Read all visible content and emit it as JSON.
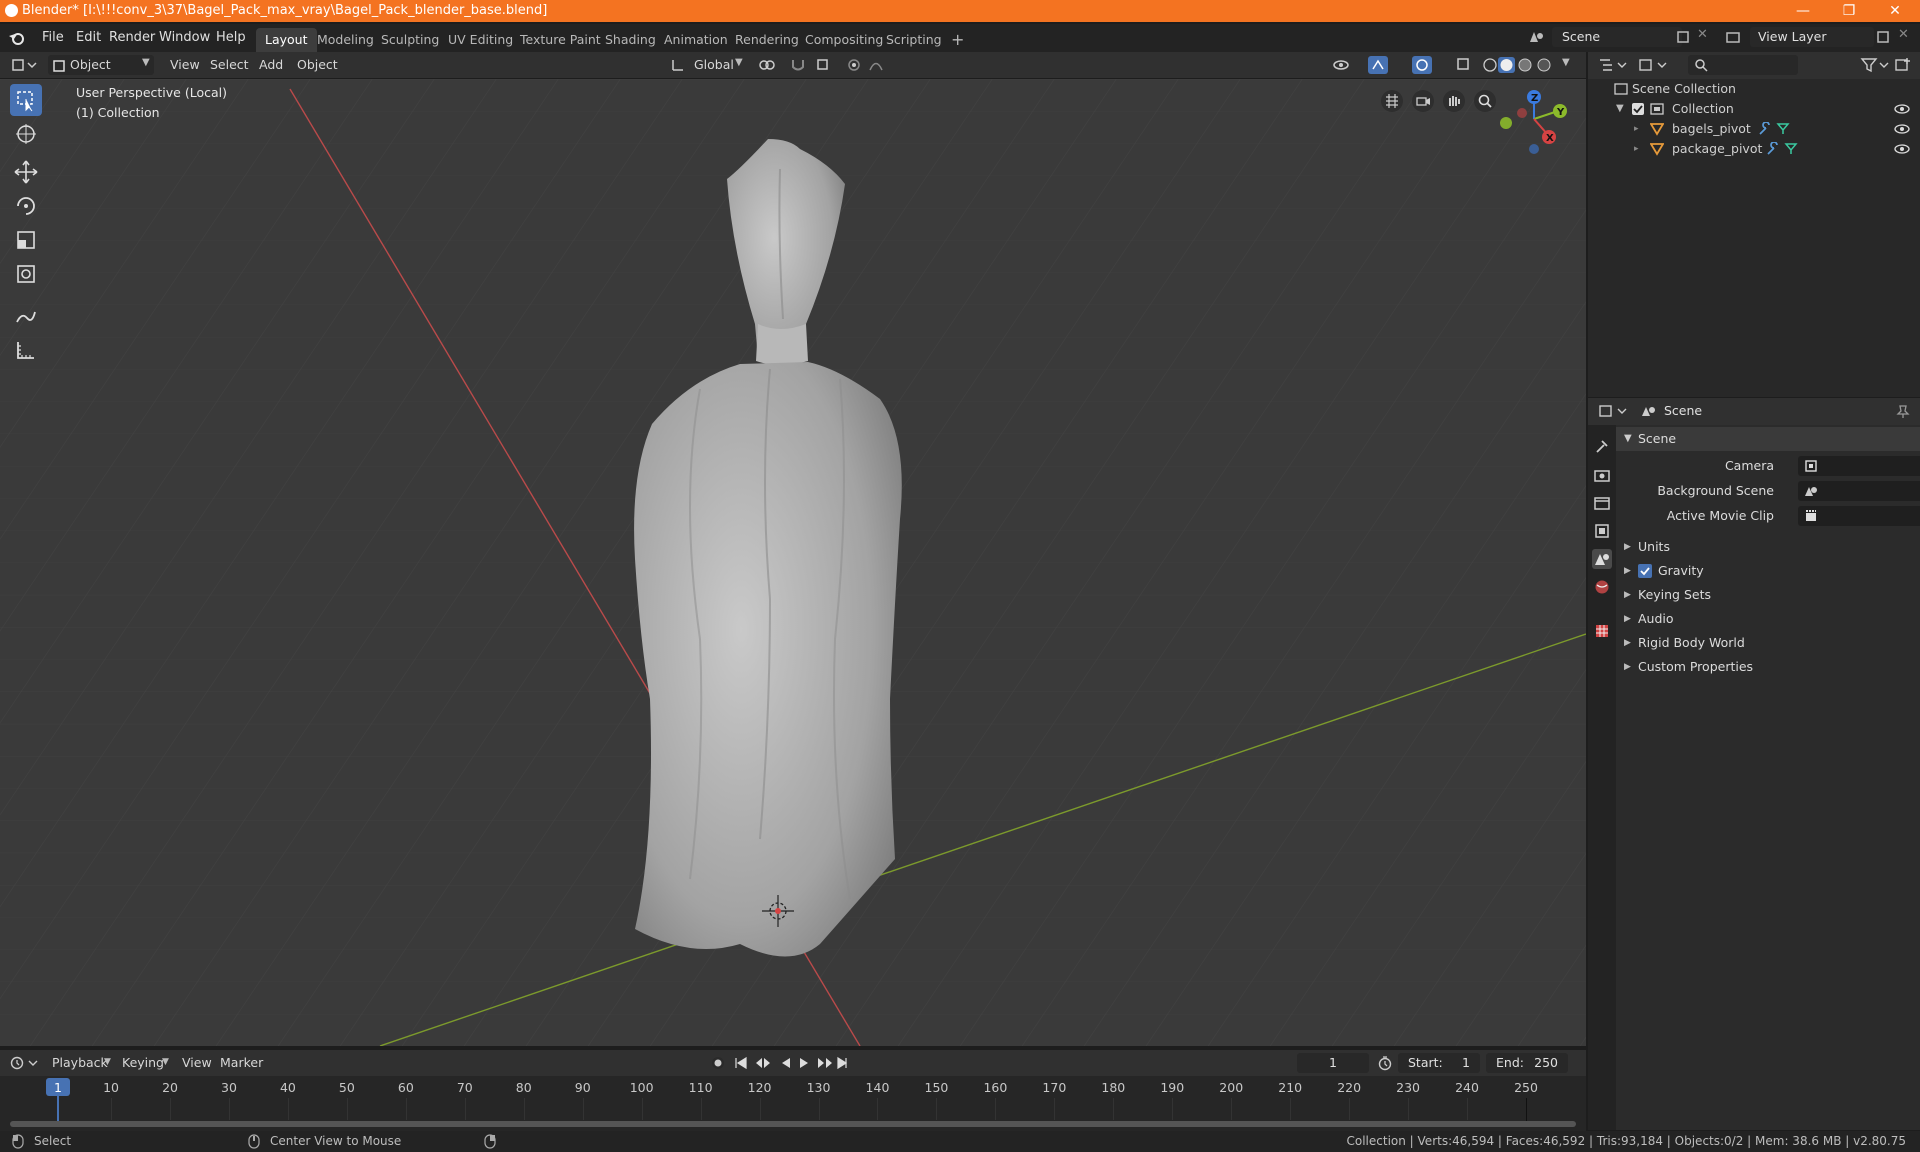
{
  "window": {
    "title": "Blender* [I:\\!!!conv_3\\37\\Bagel_Pack_max_vray\\Bagel_Pack_blender_base.blend]",
    "minimize": "—",
    "maximize": "❐",
    "close": "✕"
  },
  "menu": [
    "File",
    "Edit",
    "Render",
    "Window",
    "Help"
  ],
  "workspaces": [
    "Layout",
    "Modeling",
    "Sculpting",
    "UV Editing",
    "Texture Paint",
    "Shading",
    "Animation",
    "Rendering",
    "Compositing",
    "Scripting"
  ],
  "add_workspace": "+",
  "scene_field": "Scene",
  "view_layer_field": "View Layer",
  "viewport_header": {
    "mode": "Object Mode",
    "menus": [
      "View",
      "Select",
      "Add",
      "Object"
    ],
    "orientation": "Global"
  },
  "viewport": {
    "perspective": "User Perspective (Local)",
    "collection": "(1) Collection",
    "axes": {
      "x": "X",
      "y": "Y",
      "z": "Z"
    }
  },
  "outliner": {
    "search_placeholder": "",
    "root": "Scene Collection",
    "collection": "Collection",
    "items": [
      "bagels_pivot",
      "package_pivot"
    ]
  },
  "properties": {
    "header": "Scene",
    "panel": "Scene",
    "fields": [
      {
        "label": "Camera"
      },
      {
        "label": "Background Scene"
      },
      {
        "label": "Active Movie Clip"
      }
    ],
    "sections": [
      "Units",
      "Gravity",
      "Keying Sets",
      "Audio",
      "Rigid Body World",
      "Custom Properties"
    ],
    "gravity_checked": true
  },
  "timeline": {
    "menus": [
      "Playback",
      "Keying",
      "View",
      "Marker"
    ],
    "current_frame": "1",
    "start_label": "Start:",
    "start": "1",
    "end_label": "End:",
    "end": "250",
    "ticks": [
      "1",
      "10",
      "20",
      "30",
      "40",
      "50",
      "60",
      "70",
      "80",
      "90",
      "100",
      "110",
      "120",
      "130",
      "140",
      "150",
      "160",
      "170",
      "180",
      "190",
      "200",
      "210",
      "220",
      "230",
      "240",
      "250"
    ]
  },
  "status": {
    "select": "Select",
    "center": "Center View to Mouse",
    "stats": "Collection | Verts:46,594 | Faces:46,592 | Tris:93,184 | Objects:0/2 | Mem: 38.6 MB | v2.80.75"
  },
  "colors": {
    "accent": "#4772b3",
    "title_bar": "#f47321",
    "x_axis": "#d64343",
    "y_axis": "#8cba2b",
    "z_axis": "#3a7be0"
  }
}
